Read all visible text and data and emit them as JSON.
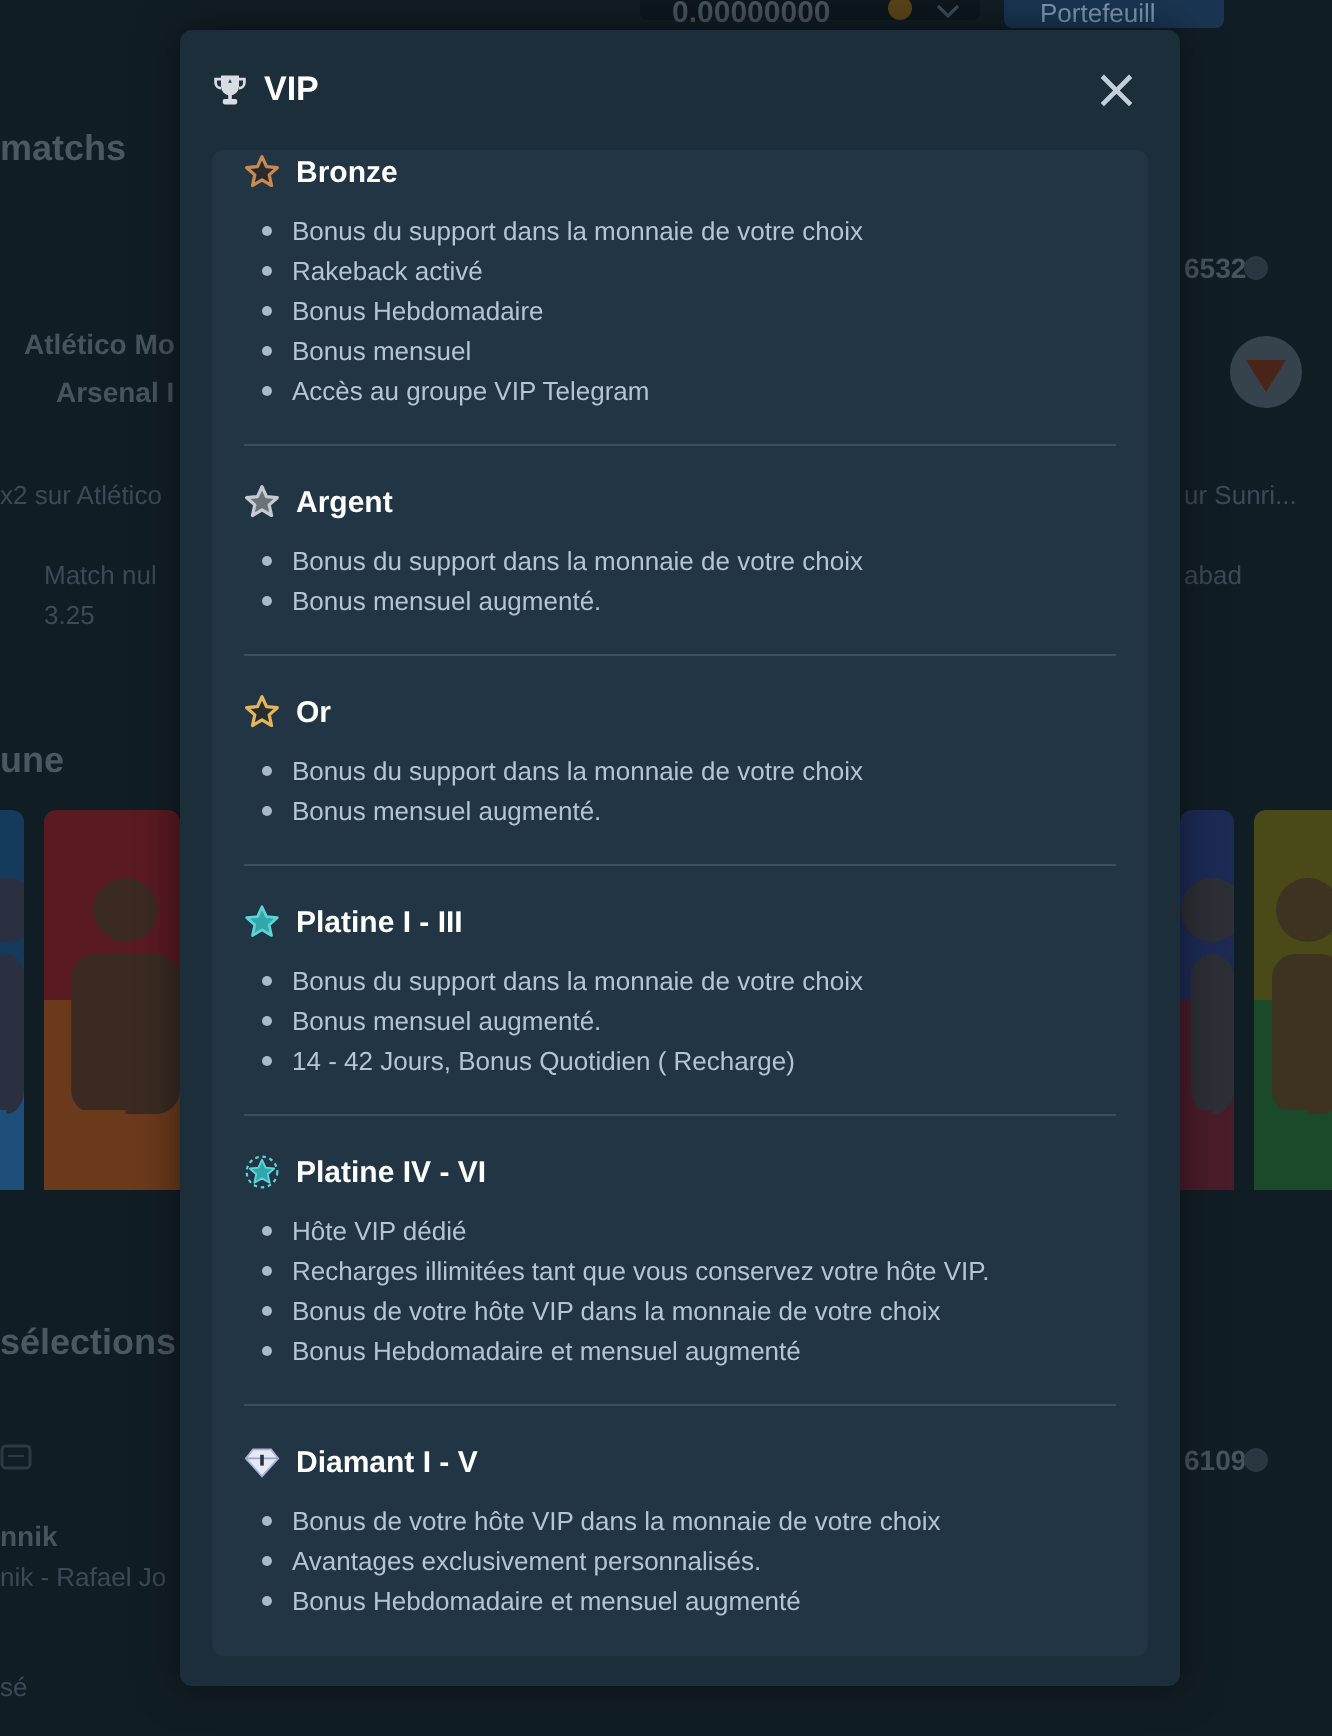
{
  "background": {
    "top_bar": {
      "balance": "0.00000000",
      "wallet_button": "Portefeuill"
    },
    "left_column": {
      "heading": "matchs",
      "team_1": "Atlético Mo",
      "team_2": "Arsenal I",
      "bet_label": "x2 sur Atlético",
      "outcome": "Match nul",
      "odds": "3.25",
      "heading_2": "une",
      "heading_3": "sélections",
      "player": "nnik",
      "match": "nik - Rafael Jo",
      "footer": "sé"
    },
    "right_column": {
      "bet_id_1": "6532",
      "bet_label": "ur Sunri...",
      "outcome": "abad",
      "bet_id_2": "6109"
    }
  },
  "modal": {
    "title": "VIP",
    "close": "×",
    "tiers": [
      {
        "name": "Bronze",
        "kind": "bronze",
        "items": [
          "Bonus du support dans la monnaie de votre choix",
          "Rakeback activé",
          "Bonus Hebdomadaire",
          "Bonus mensuel",
          "Accès au groupe VIP Telegram"
        ]
      },
      {
        "name": "Argent",
        "kind": "silver",
        "items": [
          "Bonus du support dans la monnaie de votre choix",
          "Bonus mensuel augmenté."
        ]
      },
      {
        "name": "Or",
        "kind": "gold",
        "items": [
          "Bonus du support dans la monnaie de votre choix",
          "Bonus mensuel augmenté."
        ]
      },
      {
        "name": "Platine I - III",
        "kind": "platinum",
        "items": [
          "Bonus du support dans la monnaie de votre choix",
          "Bonus mensuel augmenté.",
          "14 - 42 Jours, Bonus Quotidien ( Recharge)"
        ]
      },
      {
        "name": "Platine IV - VI",
        "kind": "platinum-plus",
        "items": [
          "Hôte VIP dédié",
          "Recharges illimitées tant que vous conservez votre hôte VIP.",
          "Bonus de votre hôte VIP dans la monnaie de votre choix",
          "Bonus Hebdomadaire et mensuel augmenté"
        ]
      },
      {
        "name": "Diamant I - V",
        "kind": "diamond",
        "items": [
          "Bonus de votre hôte VIP dans la monnaie de votre choix",
          "Avantages exclusivement personnalisés.",
          "Bonus Hebdomadaire et mensuel augmenté"
        ]
      }
    ]
  }
}
